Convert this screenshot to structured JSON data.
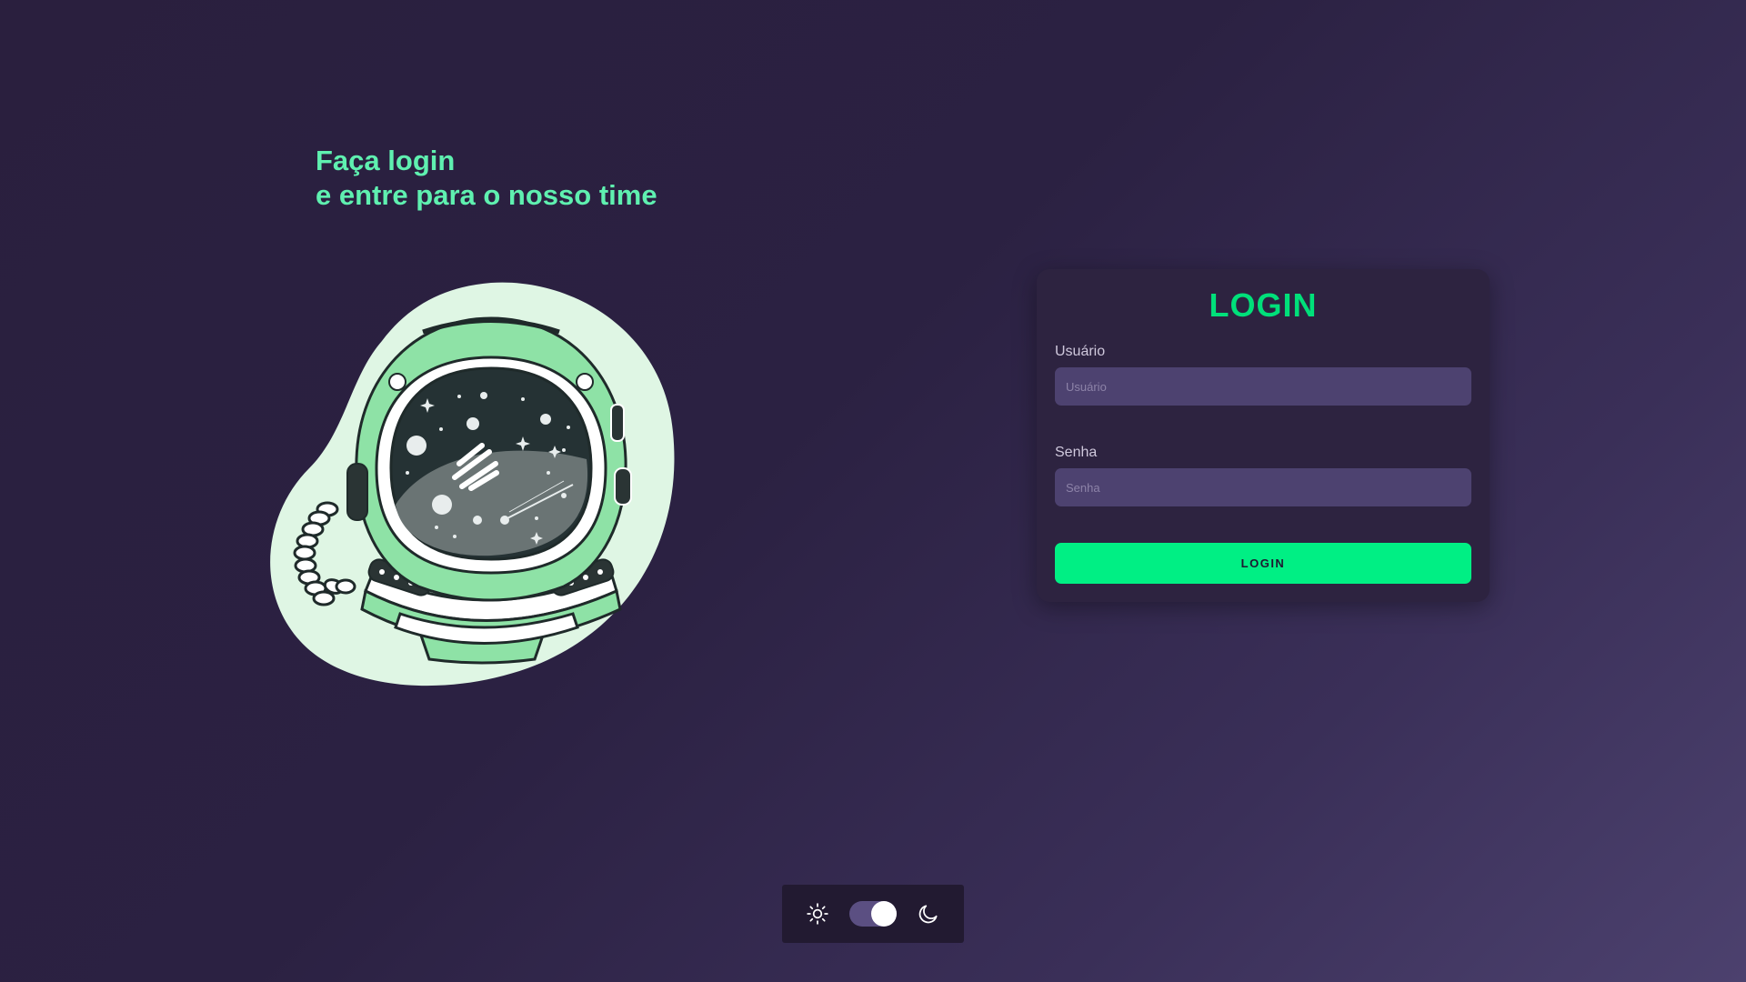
{
  "headline": {
    "line1": "Faça login",
    "line2": "e entre para o nosso time"
  },
  "illustration": {
    "icon": "astronaut-helmet-illustration",
    "accent_color": "#8ee2a6",
    "blob_color": "#dff6e4"
  },
  "login_form": {
    "title": "LOGIN",
    "username": {
      "label": "Usuário",
      "placeholder": "Usuário",
      "value": ""
    },
    "password": {
      "label": "Senha",
      "placeholder": "Senha",
      "value": ""
    },
    "submit_label": "LOGIN"
  },
  "theme_switcher": {
    "light_icon": "sun-icon",
    "dark_icon": "moon-icon",
    "mode": "dark"
  },
  "colors": {
    "accent": "#00ef84",
    "headline": "#5ff0b0",
    "card": "#2d2340",
    "input": "#4d4270"
  }
}
